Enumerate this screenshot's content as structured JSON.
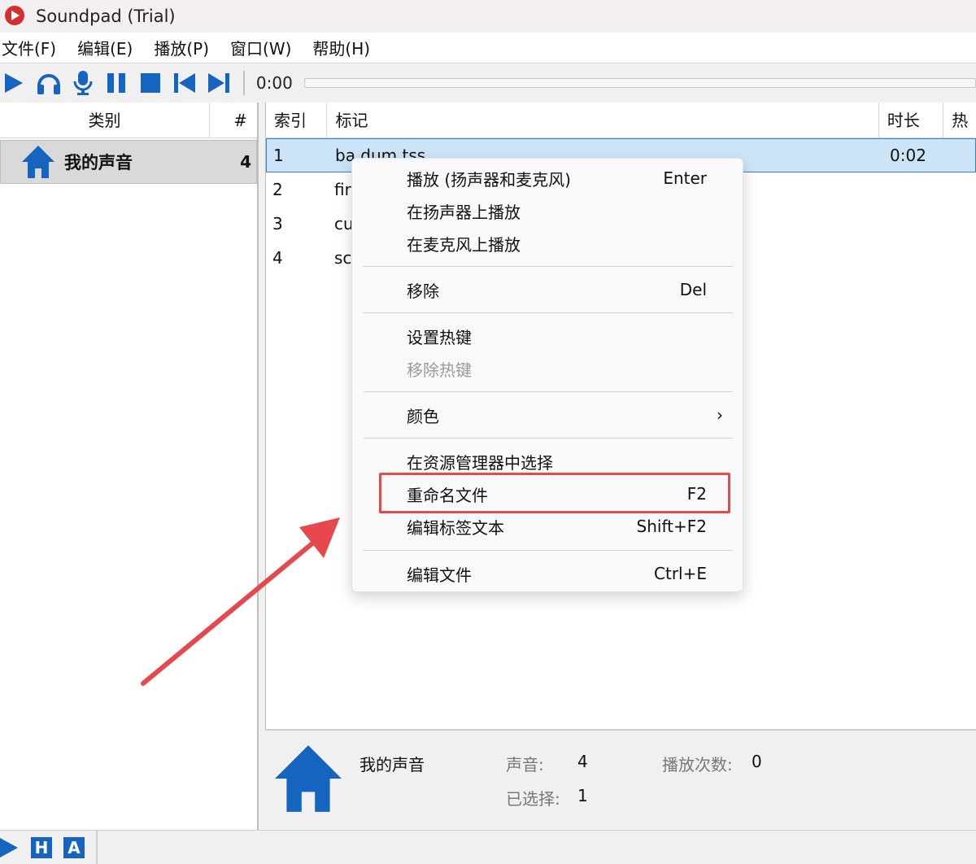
{
  "window": {
    "title": "Soundpad (Trial)"
  },
  "menubar": [
    "文件(F)",
    "编辑(E)",
    "播放(P)",
    "窗口(W)",
    "帮助(H)"
  ],
  "toolbar": {
    "icons": [
      "play-icon",
      "headphones-icon",
      "microphone-icon",
      "pause-icon",
      "stop-icon",
      "previous-icon",
      "next-icon"
    ],
    "time": "0:00"
  },
  "categories": {
    "header_label": "类别",
    "header_count": "#",
    "items": [
      {
        "name": "我的声音",
        "count": "4"
      }
    ]
  },
  "sounds": {
    "columns": [
      "索引",
      "标记",
      "时长",
      "热"
    ],
    "rows": [
      {
        "index": "1",
        "tag": "ba dum tss",
        "duration": "0:02",
        "selected": true
      },
      {
        "index": "2",
        "tag": "fir",
        "duration": "",
        "selected": false
      },
      {
        "index": "3",
        "tag": "cu",
        "duration": "",
        "selected": false
      },
      {
        "index": "4",
        "tag": "sc",
        "duration": "",
        "selected": false
      }
    ]
  },
  "context_menu": {
    "items": [
      {
        "label": "播放 (扬声器和麦克风)",
        "shortcut": "Enter"
      },
      {
        "label": "在扬声器上播放",
        "shortcut": ""
      },
      {
        "label": "在麦克风上播放",
        "shortcut": ""
      },
      {
        "label": "移除",
        "shortcut": "Del"
      },
      {
        "label": "设置热键",
        "shortcut": ""
      },
      {
        "label": "移除热键",
        "shortcut": "",
        "disabled": true
      },
      {
        "label": "颜色",
        "shortcut": ""
      },
      {
        "label": "在资源管理器中选择",
        "shortcut": ""
      },
      {
        "label": "重命名文件",
        "shortcut": "F2",
        "highlighted": true
      },
      {
        "label": "编辑标签文本",
        "shortcut": "Shift+F2"
      },
      {
        "label": "编辑文件",
        "shortcut": "Ctrl+E"
      }
    ],
    "submenu_arrow": "›"
  },
  "info": {
    "category_name": "我的声音",
    "sounds_label": "声音:",
    "sounds_value": "4",
    "plays_label": "播放次数:",
    "plays_value": "0",
    "selected_label": "已选择:",
    "selected_value": "1"
  },
  "statusbar": {
    "h_label": "H",
    "a_label": "A"
  },
  "colors": {
    "accent_blue": "#1565c0",
    "selection": "#cce4f7",
    "highlight_red": "#e5484d"
  }
}
